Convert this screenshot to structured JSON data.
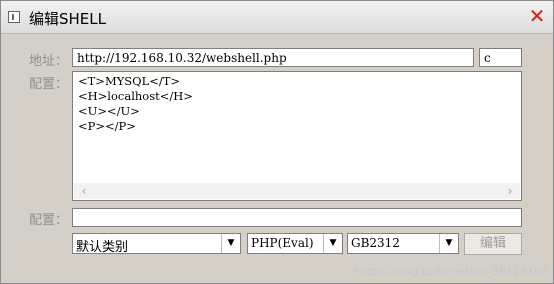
{
  "window": {
    "title": "编辑SHELL",
    "close_symbol": "✕"
  },
  "form": {
    "address_label": "地址：",
    "url_value": "http://192.168.10.32/webshell.php",
    "password_value": "c",
    "config_label": "配置：",
    "config_lines": [
      "<T>MYSQL</T>",
      "<H>localhost</H>",
      "<U></U>",
      "<P></P>"
    ],
    "scroll_left_arrow": "‹",
    "scroll_right_arrow": "›",
    "remark_label": "配置：",
    "remark_value": ""
  },
  "selects": {
    "category": "默认类别",
    "script_type": "PHP(Eval)",
    "encoding": "GB2312",
    "dropdown_arrow": "▼"
  },
  "buttons": {
    "edit_label": "编辑"
  },
  "watermark": {
    "text": "https://blog.csdn.net/qq_36119192"
  }
}
